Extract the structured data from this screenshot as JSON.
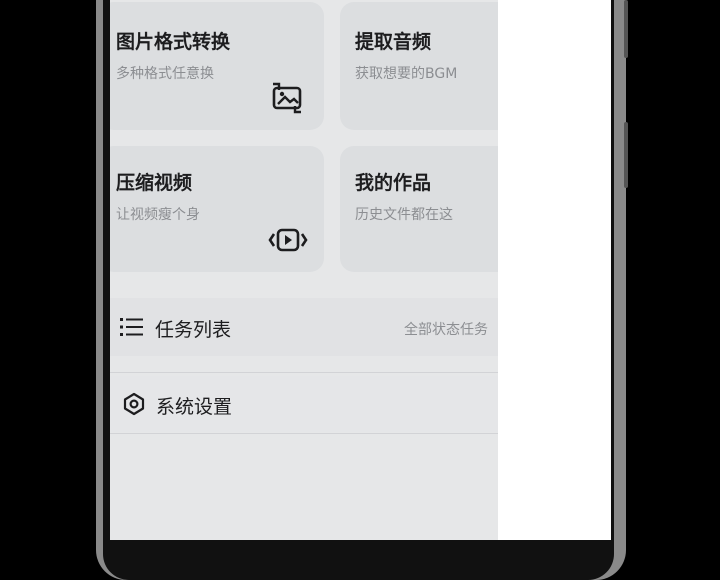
{
  "cards": [
    {
      "title": "图片格式转换",
      "subtitle": "多种格式任意换",
      "icon": "image-convert-icon"
    },
    {
      "title": "提取音频",
      "subtitle": "获取想要的BGM",
      "icon": ""
    },
    {
      "title": "压缩视频",
      "subtitle": "让视频瘦个身",
      "icon": "video-compress-icon"
    },
    {
      "title": "我的作品",
      "subtitle": "历史文件都在这",
      "icon": ""
    }
  ],
  "task_list": {
    "label": "任务列表",
    "right_text": "全部状态任务",
    "icon": "list-icon"
  },
  "settings": {
    "label": "系统设置",
    "icon": "settings-icon"
  },
  "colors": {
    "background": "#e6e7e8",
    "card": "#dcdee0",
    "text": "#1d1d1f",
    "subtext": "#8c8e92"
  }
}
